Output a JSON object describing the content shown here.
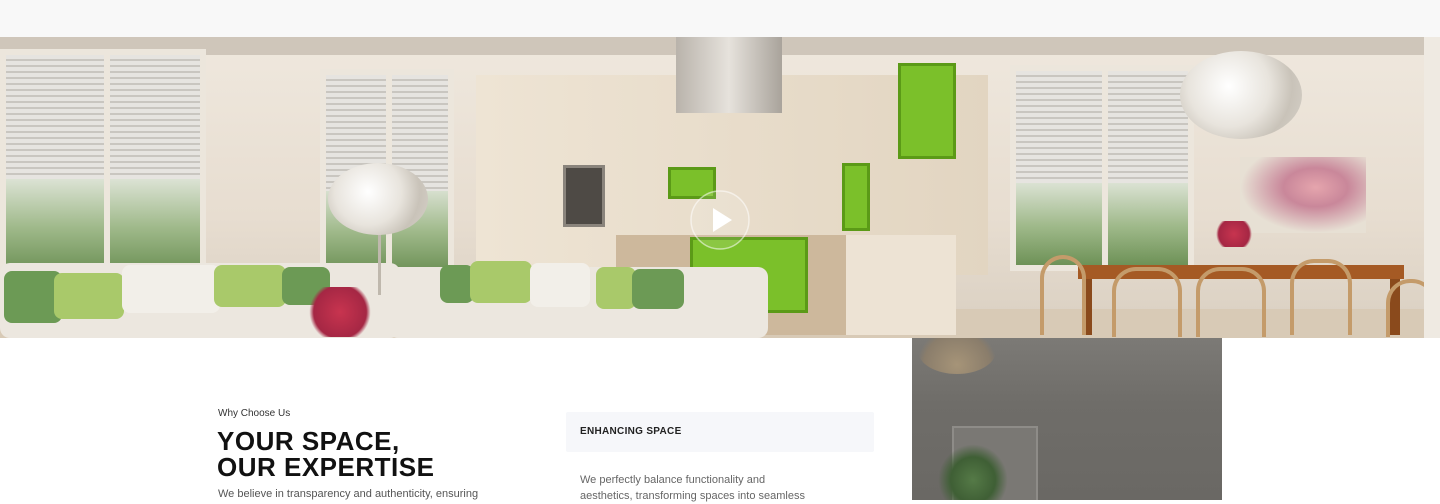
{
  "hero": {
    "play_button": {
      "icon": "play-icon",
      "color": "#ffffff"
    }
  },
  "about": {
    "eyebrow": "Why Choose Us",
    "title_line1": "YOUR SPACE,",
    "title_line2": "OUR EXPERTISE",
    "lead": "We believe in transparency and authenticity, ensuring"
  },
  "feature_card": {
    "label": "ENHANCING SPACE",
    "text_line1": "We perfectly balance functionality and",
    "text_line2": "aesthetics, transforming spaces into seamless"
  },
  "colors": {
    "accent_green": "#7bc02a",
    "heading": "#111111",
    "card_bg": "#f6f7fa"
  }
}
